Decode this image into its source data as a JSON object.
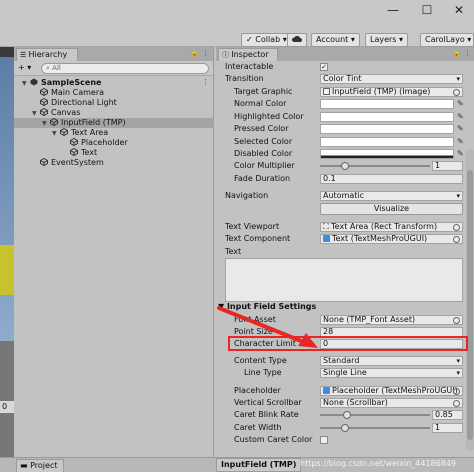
{
  "window": {
    "minimize": "—",
    "maximize": "☐",
    "close": "✕"
  },
  "toolbar": {
    "collab": "✓ Collab ▾",
    "account": "Account ▾",
    "layers": "Layers ▾",
    "layout": "CarolLayo ▾"
  },
  "hierarchy": {
    "tab": "Hierarchy",
    "add_label": "+ ▾",
    "search_placeholder": "All",
    "items": [
      {
        "label": "SampleScene",
        "depth": 0,
        "arrow": "▼",
        "type": "scene"
      },
      {
        "label": "Main Camera",
        "depth": 1,
        "arrow": "",
        "type": "object"
      },
      {
        "label": "Directional Light",
        "depth": 1,
        "arrow": "",
        "type": "object"
      },
      {
        "label": "Canvas",
        "depth": 1,
        "arrow": "▼",
        "type": "object"
      },
      {
        "label": "InputField (TMP)",
        "depth": 2,
        "arrow": "▼",
        "type": "object",
        "selected": true
      },
      {
        "label": "Text Area",
        "depth": 3,
        "arrow": "▼",
        "type": "object"
      },
      {
        "label": "Placeholder",
        "depth": 4,
        "arrow": "",
        "type": "object"
      },
      {
        "label": "Text",
        "depth": 4,
        "arrow": "",
        "type": "object"
      },
      {
        "label": "EventSystem",
        "depth": 1,
        "arrow": "",
        "type": "object"
      }
    ]
  },
  "left_strip": {
    "zero": "0"
  },
  "inspector": {
    "tab": "Inspector",
    "interactable": "Interactable",
    "transition": {
      "label": "Transition",
      "value": "Color Tint"
    },
    "target_graphic": {
      "label": "Target Graphic",
      "value": "InputField (TMP) (Image)"
    },
    "normal_color": "Normal Color",
    "highlighted_color": "Highlighted Color",
    "pressed_color": "Pressed Color",
    "selected_color": "Selected Color",
    "disabled_color": "Disabled Color",
    "color_multiplier": {
      "label": "Color Multiplier",
      "value": "1",
      "fraction": 0.2
    },
    "fade_duration": {
      "label": "Fade Duration",
      "value": "0.1"
    },
    "navigation": {
      "label": "Navigation",
      "value": "Automatic"
    },
    "visualize": "Visualize",
    "text_viewport": {
      "label": "Text Viewport",
      "value": "Text Area (Rect Transform)"
    },
    "text_component": {
      "label": "Text Component",
      "value": "Text (TextMeshProUGUI)"
    },
    "text_label": "Text",
    "section_title": "Input Field Settings",
    "font_asset": {
      "label": "Font Asset",
      "value": "None (TMP_Font Asset)"
    },
    "point_size": {
      "label": "Point Size",
      "value": "28"
    },
    "character_limit": {
      "label": "Character Limit",
      "value": "0"
    },
    "content_type": {
      "label": "Content Type",
      "value": "Standard"
    },
    "line_type": {
      "label": "Line Type",
      "value": "Single Line"
    },
    "placeholder": {
      "label": "Placeholder",
      "value": "Placeholder (TextMeshProUGUI)"
    },
    "vertical_scrollbar": {
      "label": "Vertical Scrollbar",
      "value": "None (Scrollbar)"
    },
    "caret_blink_rate": {
      "label": "Caret Blink Rate",
      "value": "0.85",
      "fraction": 0.22
    },
    "caret_width": {
      "label": "Caret Width",
      "value": "1",
      "fraction": 0.2
    },
    "custom_caret_color": "Custom Caret Color"
  },
  "bottom": {
    "project_tab": "Project",
    "selected_object": "InputField (TMP)"
  },
  "watermark": "https://blog.csdn.net/weixin_44186849",
  "colors": {
    "annotation": "#e82626",
    "selection": "#a4a4a4",
    "text_icon": "#3a8fe0"
  }
}
